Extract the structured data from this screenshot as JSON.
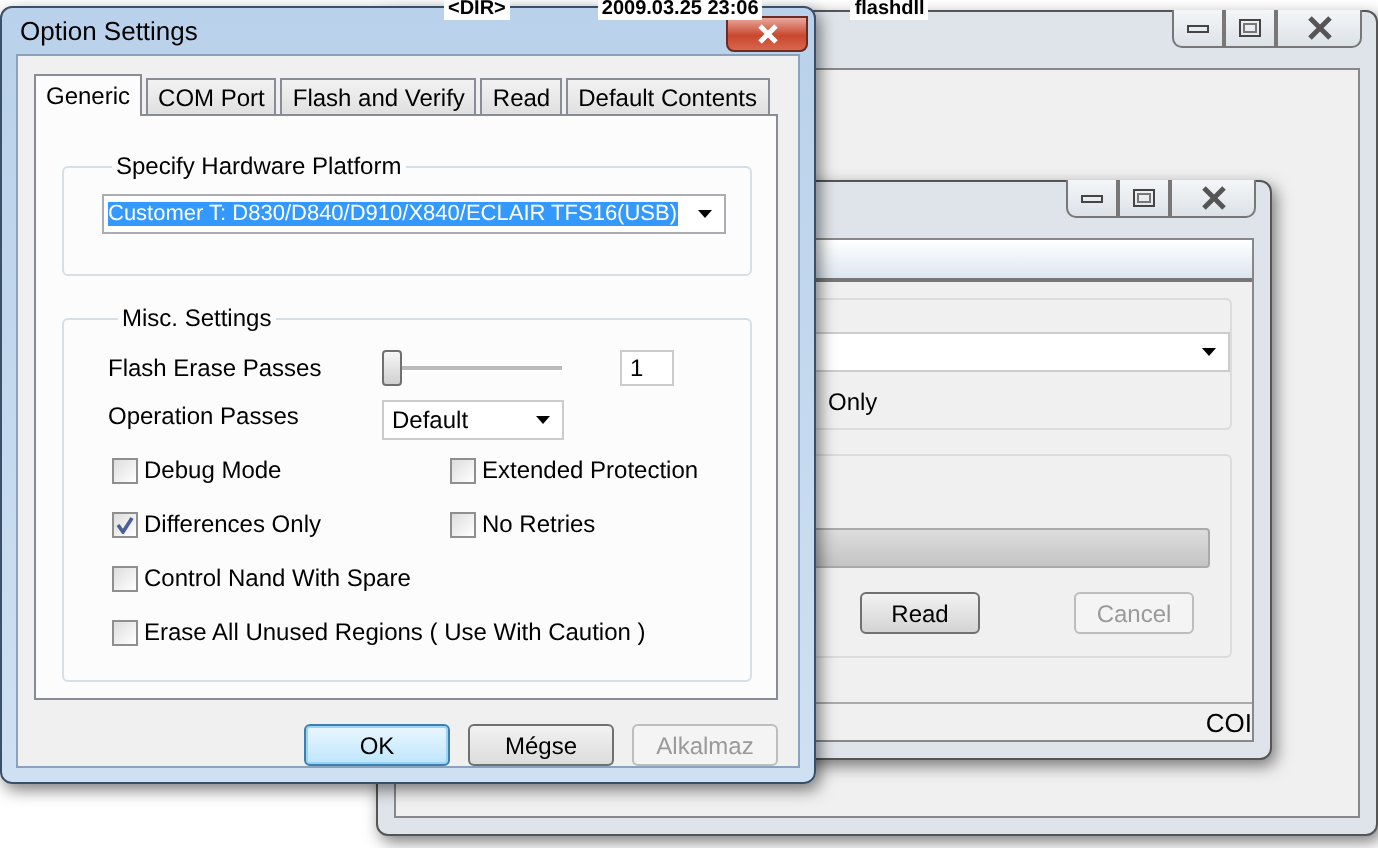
{
  "desktop_listing": {
    "column_1": "<DIR>",
    "column_2": "2009.03.25 23:06",
    "column_3": "flashdll"
  },
  "middle_window": {
    "checkbox_fragment": "Only",
    "progress": {
      "level": 0
    },
    "buttons": [
      {
        "label": "Read",
        "disabled": false
      },
      {
        "label": "Cancel",
        "disabled": true
      }
    ],
    "status_text": "COI"
  },
  "dialog": {
    "title": "Option Settings",
    "tabs": [
      {
        "label": "Generic",
        "selected": true
      },
      {
        "label": "COM Port",
        "selected": false
      },
      {
        "label": "Flash and Verify",
        "selected": false
      },
      {
        "label": "Read",
        "selected": false
      },
      {
        "label": "Default Contents",
        "selected": false
      }
    ],
    "platform_group": {
      "title": "Specify Hardware Platform",
      "value": "Customer T: D830/D840/D910/X840/ECLAIR TFS16(USB)"
    },
    "misc_group": {
      "title": "Misc. Settings",
      "flash_erase_passes": {
        "label": "Flash Erase Passes",
        "level": 0,
        "value": "1"
      },
      "operation_passes": {
        "label": "Operation Passes",
        "value": "Default"
      },
      "checkboxes": [
        {
          "label": "Debug Mode",
          "checked": false
        },
        {
          "label": "Extended Protection",
          "checked": false
        },
        {
          "label": "Differences Only",
          "checked": true
        },
        {
          "label": "No Retries",
          "checked": false
        },
        {
          "label": "Control Nand With Spare",
          "checked": false
        },
        {
          "label": "Erase All Unused Regions ( Use With Caution )",
          "checked": false
        }
      ]
    },
    "buttons": [
      {
        "label": "OK",
        "default": true,
        "disabled": false
      },
      {
        "label": "Mégse",
        "default": false,
        "disabled": false
      },
      {
        "label": "Alkalmaz",
        "default": false,
        "disabled": true
      }
    ]
  }
}
